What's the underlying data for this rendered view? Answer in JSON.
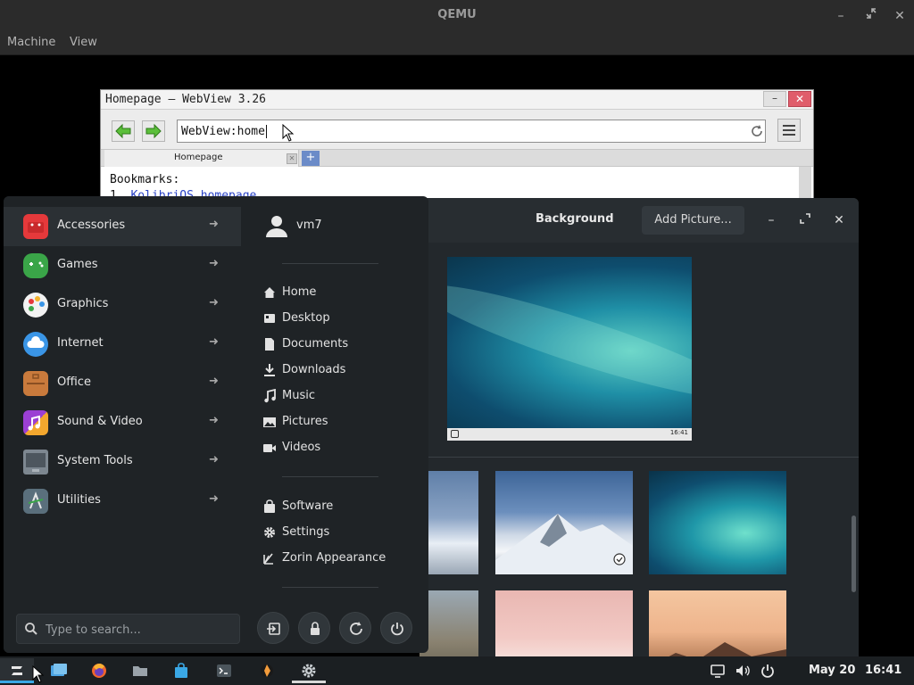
{
  "qemu": {
    "title": "QEMU",
    "menus": [
      "Machine",
      "View"
    ]
  },
  "webview": {
    "title": "Homepage – WebView 3.26",
    "url": "WebView:home",
    "tab_label": "Homepage",
    "new_tab": "+",
    "bookmarks_heading": "Bookmarks:",
    "bookmark_1_number": "1.",
    "bookmark_1_label": "KolibriOS homepage"
  },
  "background_window": {
    "title": "Background",
    "add_button": "Add Picture...",
    "preview_clock": "16:41"
  },
  "menu": {
    "categories": [
      {
        "label": "Accessories",
        "icon": "accessories-icon",
        "color": "#e5393b"
      },
      {
        "label": "Games",
        "icon": "games-icon",
        "color": "#3aa548"
      },
      {
        "label": "Graphics",
        "icon": "graphics-icon",
        "color": "#f2f2f2"
      },
      {
        "label": "Internet",
        "icon": "internet-icon",
        "color": "#3a95e6"
      },
      {
        "label": "Office",
        "icon": "office-icon",
        "color": "#c97a3c"
      },
      {
        "label": "Sound & Video",
        "icon": "sound-video-icon",
        "color": "#9b3fd4"
      },
      {
        "label": "System Tools",
        "icon": "system-tools-icon",
        "color": "#7d8790"
      },
      {
        "label": "Utilities",
        "icon": "utilities-icon",
        "color": "#5a6f7c"
      }
    ],
    "user": "vm7",
    "places": [
      "Home",
      "Desktop",
      "Documents",
      "Downloads",
      "Music",
      "Pictures",
      "Videos"
    ],
    "system": [
      "Software",
      "Settings",
      "Zorin Appearance"
    ],
    "search_placeholder": "Type to search..."
  },
  "taskbar": {
    "date": "May 20",
    "time": "16:41"
  }
}
